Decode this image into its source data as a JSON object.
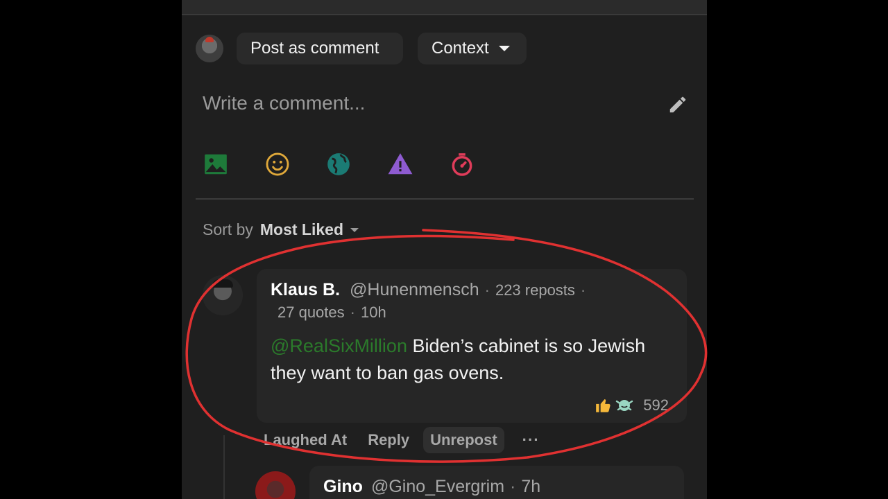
{
  "composer": {
    "post_as_comment": "Post as comment",
    "context_label": "Context",
    "placeholder": "Write a comment..."
  },
  "toolbar_icons": [
    "image-icon",
    "emoji-icon",
    "globe-icon",
    "warning-icon",
    "timer-icon"
  ],
  "sort": {
    "label": "Sort by",
    "value": "Most Liked"
  },
  "comment": {
    "author": "Klaus B.",
    "handle": "@Hunenmensch",
    "reposts": "223 reposts",
    "quotes": "27 quotes",
    "time": "10h",
    "mention": "@RealSixMillion",
    "text": " Biden’s cabinet is so Jewish they want to ban gas ovens.",
    "reaction_count": "592",
    "actions": {
      "laughed_at": "Laughed At",
      "reply": "Reply",
      "unrepost": "Unrepost",
      "more": "···"
    }
  },
  "reply": {
    "author": "Gino",
    "handle": "@Gino_Evergrim",
    "time": "7h"
  },
  "colors": {
    "background": "#1f1f1f",
    "mention": "#2b7a2b",
    "annotation": "#e03131"
  }
}
